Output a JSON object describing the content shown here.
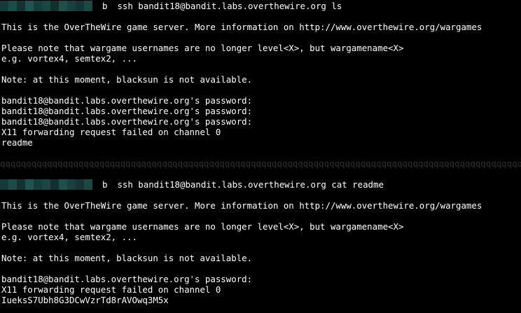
{
  "colors": {
    "background": "#000000",
    "text": "#ffffff",
    "separator": "#2f2f2f",
    "redaction": [
      "#163a38",
      "#1d4b47",
      "#143231",
      "#205450",
      "#173d3a",
      "#1b4642",
      "#12302e",
      "#1e4f4b",
      "#184140",
      "#153634",
      "#1c4944"
    ]
  },
  "session1": {
    "prompt_symbol": "b",
    "command": "ssh bandit18@bandit.labs.overthewire.org ls",
    "banner": "This is the OverTheWire game server. More information on http://www.overthewire.org/wargames",
    "note_usernames": "Please note that wargame usernames are no longer level<X>, but wargamename<X>",
    "note_examples": "e.g. vortex4, semtex2, ...",
    "note_blacksun": "Note: at this moment, blacksun is not available.",
    "password_prompts": [
      "bandit18@bandit.labs.overthewire.org's password:",
      "bandit18@bandit.labs.overthewire.org's password:",
      "bandit18@bandit.labs.overthewire.org's password:"
    ],
    "x11_error": "X11 forwarding request failed on channel 0",
    "output": "readme"
  },
  "separator_text": "qqqqqqqqqqqqqqqqqqqqqqqqqqqqqqqqqqqqqqqqqqqqqqqqqqqqqqqqqqqqqqqqqqqqqqqqqqqqqqqqqqqqqqqqqqqqqqqqqqqqqqqqqqq",
  "session2": {
    "prompt_symbol": "b",
    "command": "ssh bandit18@bandit.labs.overthewire.org cat readme",
    "banner": "This is the OverTheWire game server. More information on http://www.overthewire.org/wargames",
    "note_usernames": "Please note that wargame usernames are no longer level<X>, but wargamename<X>",
    "note_examples": "e.g. vortex4, semtex2, ...",
    "note_blacksun": "Note: at this moment, blacksun is not available.",
    "password_prompt": "bandit18@bandit.labs.overthewire.org's password:",
    "x11_error": "X11 forwarding request failed on channel 0",
    "output": "IueksS7Ubh8G3DCwVzrTd8rAVOwq3M5x"
  }
}
